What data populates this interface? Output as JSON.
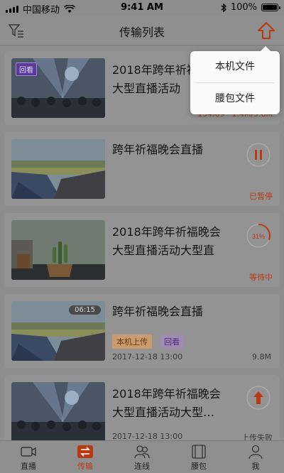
{
  "status_bar": {
    "carrier": "中国移动",
    "time": "9:41 AM",
    "battery": "100%"
  },
  "nav": {
    "title": "传输列表"
  },
  "dropdown": {
    "items": [
      "本机文件",
      "腰包文件"
    ]
  },
  "cards": [
    {
      "title": "2018年跨年祈福晚会大型直播活动",
      "badge": "回看",
      "speed": "134K/s · 1.4M/9.8M"
    },
    {
      "title": "跨年祈福晚会直播",
      "status": "已暂停"
    },
    {
      "title": "2018年跨年祈福晚会大型直播活动大型直",
      "progress_label": "31%",
      "progress": 0.31,
      "status": "等待中"
    },
    {
      "title": "跨年祈福晚会直播",
      "duration": "06:15",
      "tags": [
        "本机上传",
        "回看"
      ],
      "date": "2017-12-18 13:00",
      "size": "9.8M"
    },
    {
      "title": "2018年跨年祈福晚会大型直播活动大型…",
      "date": "2017-12-18 13:00",
      "status": "上传失败"
    }
  ],
  "tabs": [
    {
      "label": "直播",
      "icon": "live-icon",
      "active": false
    },
    {
      "label": "传输",
      "icon": "transfer-icon",
      "active": true
    },
    {
      "label": "连线",
      "icon": "connect-icon",
      "active": false
    },
    {
      "label": "腰包",
      "icon": "waistbag-icon",
      "active": false
    },
    {
      "label": "我",
      "icon": "profile-icon",
      "active": false
    }
  ],
  "colors": {
    "accent": "#b83a12",
    "overlay_bg": "#8d8d8d",
    "card_bg": "#939393"
  }
}
